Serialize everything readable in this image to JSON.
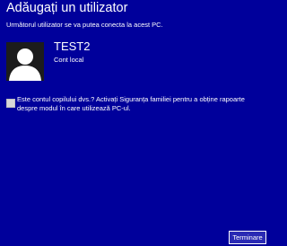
{
  "header": {
    "title": "Adăugați un utilizator",
    "subtitle": "Următorul utilizator se va putea conecta la acest PC."
  },
  "user": {
    "avatar_icon": "user-silhouette-icon",
    "name": "TEST2",
    "account_type": "Cont local"
  },
  "family_safety": {
    "checked": false,
    "label": "Este contul copilului dvs.? Activați Siguranța familiei pentru a obține rapoarte despre modul în care utilizează PC-ul."
  },
  "footer": {
    "finish_label": "Terminare"
  },
  "colors": {
    "background": "#00009b",
    "text": "#ffffff",
    "avatar_background": "#1c1c1c",
    "avatar_figure": "#ffffff",
    "checkbox": "#d8d8d8",
    "button_background": "#2a2ab4"
  }
}
